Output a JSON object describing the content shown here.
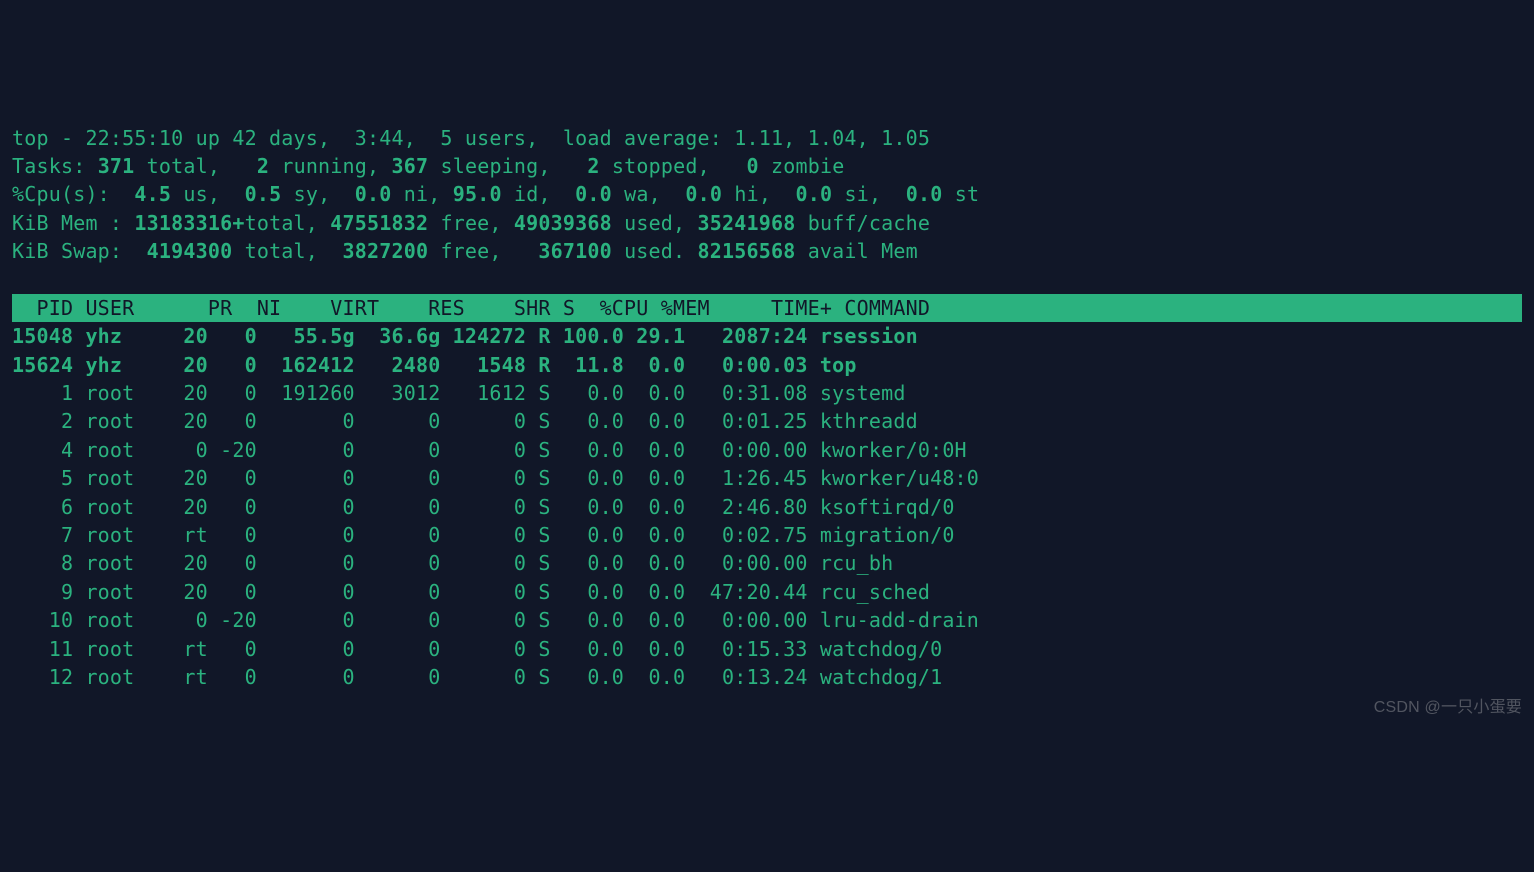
{
  "header": {
    "line1_pre": "top - 22:55:10 up 42 days,  3:44,  5 users,  load average: 1.11, 1.04, 1.05",
    "tasks_label": "Tasks: ",
    "tasks_total": "371",
    "tasks_total_suffix": " total,   ",
    "tasks_running": "2",
    "tasks_running_suffix": " running, ",
    "tasks_sleeping": "367",
    "tasks_sleeping_suffix": " sleeping,   ",
    "tasks_stopped": "2",
    "tasks_stopped_suffix": " stopped,   ",
    "tasks_zombie": "0",
    "tasks_zombie_suffix": " zombie",
    "cpu_label": "%Cpu(s):  ",
    "cpu_us": "4.5",
    "cpu_us_suffix": " us,  ",
    "cpu_sy": "0.5",
    "cpu_sy_suffix": " sy,  ",
    "cpu_ni": "0.0",
    "cpu_ni_suffix": " ni, ",
    "cpu_id": "95.0",
    "cpu_id_suffix": " id,  ",
    "cpu_wa": "0.0",
    "cpu_wa_suffix": " wa,  ",
    "cpu_hi": "0.0",
    "cpu_hi_suffix": " hi,  ",
    "cpu_si": "0.0",
    "cpu_si_suffix": " si,  ",
    "cpu_st": "0.0",
    "cpu_st_suffix": " st",
    "mem_label": "KiB Mem : ",
    "mem_total": "13183316+",
    "mem_total_suffix": "total, ",
    "mem_free": "47551832",
    "mem_free_suffix": " free, ",
    "mem_used": "49039368",
    "mem_used_suffix": " used, ",
    "mem_buff": "35241968",
    "mem_buff_suffix": " buff/cache",
    "swap_label": "KiB Swap:  ",
    "swap_total": "4194300",
    "swap_total_suffix": " total,  ",
    "swap_free": "3827200",
    "swap_free_suffix": " free,   ",
    "swap_used": "367100",
    "swap_used_suffix": " used. ",
    "swap_avail": "82156568",
    "swap_avail_suffix": " avail Mem "
  },
  "columns": "  PID USER      PR  NI    VIRT    RES    SHR S  %CPU %MEM     TIME+ COMMAND                                         ",
  "rows": [
    {
      "bold": true,
      "pid": "15048",
      "user": "yhz ",
      "pr": "20",
      "ni": "0",
      "virt": "55.5g",
      "res": "36.6g",
      "shr": "124272",
      "s": "R",
      "cpu": "100.0",
      "mem": "29.1",
      "time": "2087:24",
      "cmd": "rsession"
    },
    {
      "bold": true,
      "pid": "15624",
      "user": "yhz ",
      "pr": "20",
      "ni": "0",
      "virt": "162412",
      "res": "2480",
      "shr": "1548",
      "s": "R",
      "cpu": "11.8",
      "mem": "0.0",
      "time": "0:00.03",
      "cmd": "top"
    },
    {
      "bold": false,
      "pid": "1",
      "user": "root",
      "pr": "20",
      "ni": "0",
      "virt": "191260",
      "res": "3012",
      "shr": "1612",
      "s": "S",
      "cpu": "0.0",
      "mem": "0.0",
      "time": "0:31.08",
      "cmd": "systemd"
    },
    {
      "bold": false,
      "pid": "2",
      "user": "root",
      "pr": "20",
      "ni": "0",
      "virt": "0",
      "res": "0",
      "shr": "0",
      "s": "S",
      "cpu": "0.0",
      "mem": "0.0",
      "time": "0:01.25",
      "cmd": "kthreadd"
    },
    {
      "bold": false,
      "pid": "4",
      "user": "root",
      "pr": "0",
      "ni": "-20",
      "virt": "0",
      "res": "0",
      "shr": "0",
      "s": "S",
      "cpu": "0.0",
      "mem": "0.0",
      "time": "0:00.00",
      "cmd": "kworker/0:0H"
    },
    {
      "bold": false,
      "pid": "5",
      "user": "root",
      "pr": "20",
      "ni": "0",
      "virt": "0",
      "res": "0",
      "shr": "0",
      "s": "S",
      "cpu": "0.0",
      "mem": "0.0",
      "time": "1:26.45",
      "cmd": "kworker/u48:0"
    },
    {
      "bold": false,
      "pid": "6",
      "user": "root",
      "pr": "20",
      "ni": "0",
      "virt": "0",
      "res": "0",
      "shr": "0",
      "s": "S",
      "cpu": "0.0",
      "mem": "0.0",
      "time": "2:46.80",
      "cmd": "ksoftirqd/0"
    },
    {
      "bold": false,
      "pid": "7",
      "user": "root",
      "pr": "rt",
      "ni": "0",
      "virt": "0",
      "res": "0",
      "shr": "0",
      "s": "S",
      "cpu": "0.0",
      "mem": "0.0",
      "time": "0:02.75",
      "cmd": "migration/0"
    },
    {
      "bold": false,
      "pid": "8",
      "user": "root",
      "pr": "20",
      "ni": "0",
      "virt": "0",
      "res": "0",
      "shr": "0",
      "s": "S",
      "cpu": "0.0",
      "mem": "0.0",
      "time": "0:00.00",
      "cmd": "rcu_bh"
    },
    {
      "bold": false,
      "pid": "9",
      "user": "root",
      "pr": "20",
      "ni": "0",
      "virt": "0",
      "res": "0",
      "shr": "0",
      "s": "S",
      "cpu": "0.0",
      "mem": "0.0",
      "time": "47:20.44",
      "cmd": "rcu_sched"
    },
    {
      "bold": false,
      "pid": "10",
      "user": "root",
      "pr": "0",
      "ni": "-20",
      "virt": "0",
      "res": "0",
      "shr": "0",
      "s": "S",
      "cpu": "0.0",
      "mem": "0.0",
      "time": "0:00.00",
      "cmd": "lru-add-drain"
    },
    {
      "bold": false,
      "pid": "11",
      "user": "root",
      "pr": "rt",
      "ni": "0",
      "virt": "0",
      "res": "0",
      "shr": "0",
      "s": "S",
      "cpu": "0.0",
      "mem": "0.0",
      "time": "0:15.33",
      "cmd": "watchdog/0"
    },
    {
      "bold": false,
      "pid": "12",
      "user": "root",
      "pr": "rt",
      "ni": "0",
      "virt": "0",
      "res": "0",
      "shr": "0",
      "s": "S",
      "cpu": "0.0",
      "mem": "0.0",
      "time": "0:13.24",
      "cmd": "watchdog/1"
    }
  ],
  "watermark": "CSDN @一只小蛋要"
}
